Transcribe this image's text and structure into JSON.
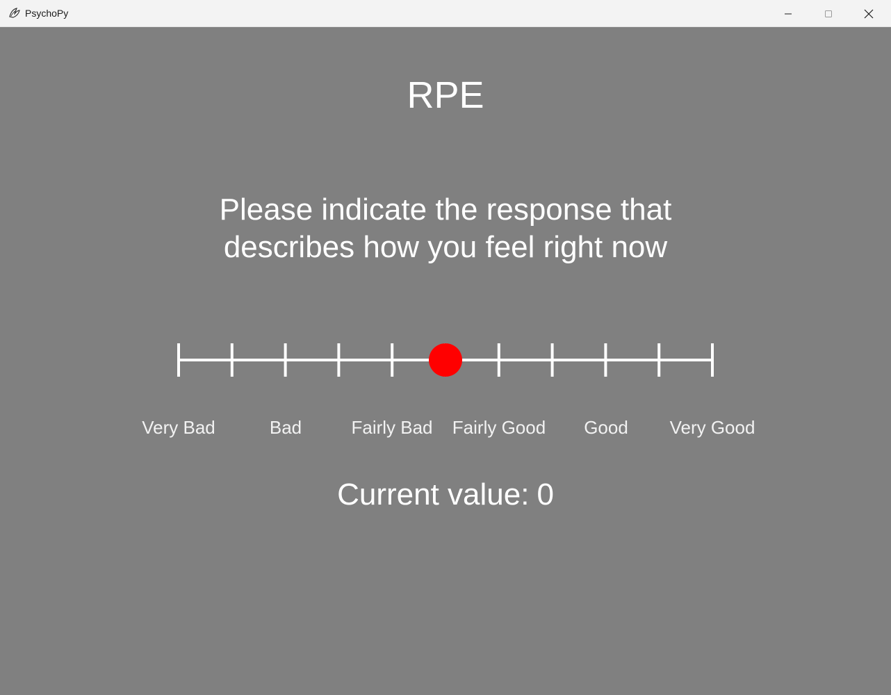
{
  "window": {
    "title": "PsychoPy",
    "app_icon": "psychopy-icon",
    "controls": {
      "minimize_icon": "minimize-icon",
      "maximize_icon": "maximize-icon",
      "close_icon": "close-icon"
    }
  },
  "screen": {
    "background_color": "#808080",
    "heading": "RPE",
    "instructions_line1": "Please indicate the response that",
    "instructions_line2": "describes how you feel right now"
  },
  "slider": {
    "tick_count": 11,
    "min": -5,
    "max": 5,
    "marker_value": 0,
    "marker_color": "#ff0000",
    "line_color": "#ffffff",
    "labels": [
      "Very Bad",
      "Bad",
      "Fairly Bad",
      "Fairly Good",
      "Good",
      "Very Good"
    ]
  },
  "readout": {
    "prefix": "Current value:",
    "value": "0"
  }
}
